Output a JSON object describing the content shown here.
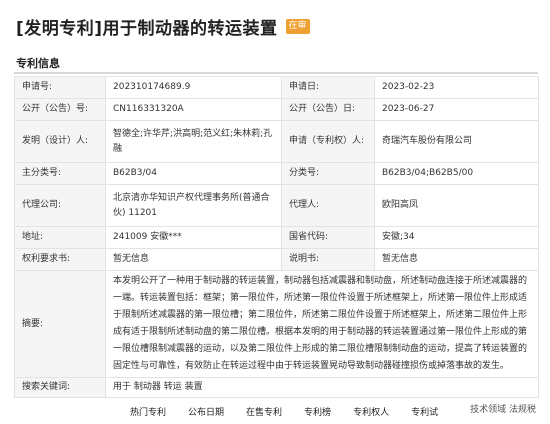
{
  "header": {
    "title": "[发明专利]用于制动器的转运装置",
    "badge": "在审"
  },
  "section": {
    "title": "专利信息"
  },
  "fields": {
    "app_no": {
      "label": "申请号:",
      "value": "202310174689.9"
    },
    "app_date": {
      "label": "申请日:",
      "value": "2023-02-23"
    },
    "pub_no": {
      "label": "公开（公告）号:",
      "value": "CN116331320A"
    },
    "pub_date": {
      "label": "公开（公告）日:",
      "value": "2023-06-27"
    },
    "inventor": {
      "label": "发明（设计）人:",
      "value": "智德全;许华芹;洪高明;范义红;朱林莉;孔融"
    },
    "applicant": {
      "label": "申请（专利权）人:",
      "value": "奇瑞汽车股份有限公司"
    },
    "main_class": {
      "label": "主分类号:",
      "value": "B62B3/04"
    },
    "class_no": {
      "label": "分类号:",
      "value": "B62B3/04;B62B5/00"
    },
    "agency": {
      "label": "代理公司:",
      "value": "北京清亦华知识产权代理事务所(普通合伙) 11201"
    },
    "agent": {
      "label": "代理人:",
      "value": "欧阳高凤"
    },
    "address": {
      "label": "地址:",
      "value": "241009 安徽***"
    },
    "country_code": {
      "label": "国省代码:",
      "value": "安徽;34"
    },
    "claims": {
      "label": "权利要求书:",
      "value": "暂无信息"
    },
    "description": {
      "label": "说明书:",
      "value": "暂无信息"
    },
    "abstract": {
      "label": "摘要:",
      "value": "本发明公开了一种用于制动器的转运装置，制动器包括减震器和制动盘，所述制动盘连接于所述减震器的一端。转运装置包括：框架；第一限位件，所述第一限位件设置于所述框架上，所述第一限位件上形成适于限制所述减震器的第一限位槽；第二限位件，所述第二限位件设置于所述框架上，所述第二限位件上形成有适于限制所述制动盘的第二限位槽。根据本发明的用于制动器的转运装置通过第一限位件上形成的第一限位槽限制减震器的运动，以及第二限位件上形成的第二限位槽限制制动盘的运动，提高了转运装置的固定性与可靠性，有效防止在转运过程中由于转运装置晃动导致制动器碰撞损伤或掉落事故的发生。"
    },
    "keywords": {
      "label": "搜索关键词:",
      "value": "用于 制动器 转运 装置"
    }
  },
  "tabs": [
    "热门专利",
    "公布日期",
    "在售专利",
    "专利榜",
    "专利权人",
    "专利试",
    "技术领域",
    "法规税"
  ],
  "watermark": "技术领域  法规税"
}
